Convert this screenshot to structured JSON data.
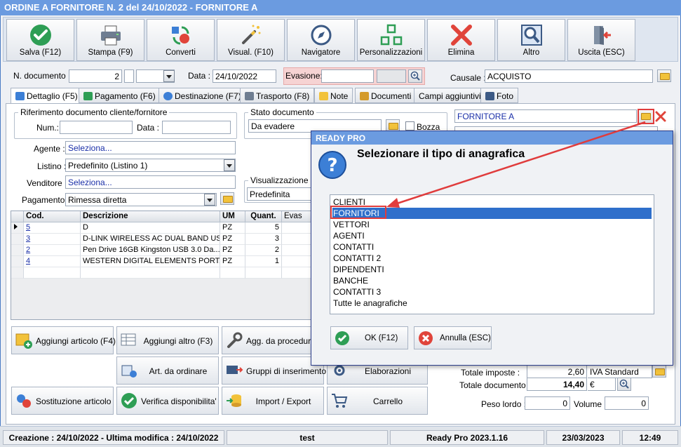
{
  "window": {
    "title": "ORDINE A FORNITORE N. 2 del 24/10/2022 - FORNITORE A"
  },
  "toolbar": {
    "buttons": [
      {
        "label": "Salva (F12)",
        "icon": "check-circle-icon"
      },
      {
        "label": "Stampa (F9)",
        "icon": "printer-icon"
      },
      {
        "label": "Converti",
        "icon": "convert-icon"
      },
      {
        "label": "Visual. (F10)",
        "icon": "magic-wand-icon"
      },
      {
        "label": "Navigatore",
        "icon": "compass-icon"
      },
      {
        "label": "Personalizzazioni",
        "icon": "grid-icon"
      },
      {
        "label": "Elimina",
        "icon": "x-icon"
      },
      {
        "label": "Altro",
        "icon": "magnifier-icon"
      },
      {
        "label": "Uscita (ESC)",
        "icon": "exit-door-icon"
      }
    ]
  },
  "header": {
    "n_documento_label": "N. documento :",
    "n_documento_value": "2",
    "data_label": "Data :",
    "data_value": "24/10/2022",
    "evasione_label": "Evasione:",
    "evasione_value": "",
    "causale_label": "Causale :",
    "causale_value": "ACQUISTO"
  },
  "tabs": [
    {
      "label": "Dettaglio (F5)",
      "active": true
    },
    {
      "label": "Pagamento (F6)"
    },
    {
      "label": "Destinazione (F7)"
    },
    {
      "label": "Trasporto (F8)"
    },
    {
      "label": "Note"
    },
    {
      "label": "Documenti"
    },
    {
      "label": "Campi aggiuntivi"
    },
    {
      "label": "Foto"
    }
  ],
  "riferimento": {
    "title": "Riferimento documento cliente/fornitore",
    "num_label": "Num.:",
    "num_value": "",
    "data_label": "Data :",
    "data_value": ""
  },
  "stato": {
    "title": "Stato documento",
    "value": "Da evadere",
    "bozza_label": "Bozza",
    "bozza_checked": false
  },
  "fornitore": {
    "value": "FORNITORE A"
  },
  "form": {
    "agente_label": "Agente :",
    "agente_value": "Seleziona...",
    "listino_label": "Listino :",
    "listino_value": "Predefinito (Listino 1)",
    "venditore_label": "Venditore :",
    "venditore_value": "Seleziona...",
    "pagamento_label": "Pagamento :",
    "pagamento_value": "Rimessa diretta",
    "visualizzazione_title": "Visualizzazione",
    "visualizzazione_value": "Predefinita"
  },
  "grid": {
    "columns": [
      "Cod.",
      "Descrizione",
      "UM",
      "Quant.",
      "Evas"
    ],
    "rows": [
      {
        "cod": "5",
        "descrizione": "D",
        "um": "PZ",
        "quant": "5"
      },
      {
        "cod": "3",
        "descrizione": "D-LINK WIRELESS AC DUAL BAND US...",
        "um": "PZ",
        "quant": "3"
      },
      {
        "cod": "2",
        "descrizione": "Pen Drive 16GB  Kingston  USB 3.0 Da...",
        "um": "PZ",
        "quant": "2"
      },
      {
        "cod": "4",
        "descrizione": "WESTERN DIGITAL ELEMENTS PORTA...",
        "um": "PZ",
        "quant": "1"
      }
    ]
  },
  "actions": {
    "aggiungi_articolo": "Aggiungi articolo (F4)",
    "aggiungi_altro": "Aggiungi altro (F3)",
    "agg_da_procedura": "Agg. da procedura",
    "art_da_ordinare": "Art. da ordinare",
    "gruppi_inserimento": "Gruppi di inserimento",
    "elaborazioni": "Elaborazioni",
    "sostituzione_articolo": "Sostituzione articolo",
    "verifica_disponibilita": "Verifica disponibilita'",
    "import_export": "Import / Export",
    "carrello": "Carrello"
  },
  "totals": {
    "totale_imposte_label": "Totale imposte :",
    "totale_imposte_value": "2,60",
    "iva_value": "IVA Standard",
    "totale_documento_label": "Totale documento :",
    "totale_documento_value": "14,40",
    "currency": "€",
    "peso_lordo_label": "Peso lordo :",
    "peso_lordo_value": "0",
    "volume_label": "Volume :",
    "volume_value": "0"
  },
  "statusbar": {
    "creazione": "Creazione : 24/10/2022 - Ultima modifica : 24/10/2022",
    "user": "test",
    "version": "Ready Pro 2023.1.16",
    "date": "23/03/2023",
    "time": "12:49"
  },
  "dialog": {
    "title": "READY PRO",
    "message": "Selezionare il tipo di anagrafica",
    "options": [
      "CLIENTI",
      "FORNITORI",
      "VETTORI",
      "AGENTI",
      "CONTATTI",
      "CONTATTI 2",
      "DIPENDENTI",
      "BANCHE",
      "CONTATTI 3",
      "Tutte le anagrafiche"
    ],
    "selected_index": 1,
    "ok_label": "OK (F12)",
    "cancel_label": "Annulla (ESC)"
  },
  "colors": {
    "titlebar": "#6b9be0",
    "selection": "#2f6fcb",
    "highlight_red": "#e03c3c",
    "evasione_bg": "#f6d3d3"
  }
}
